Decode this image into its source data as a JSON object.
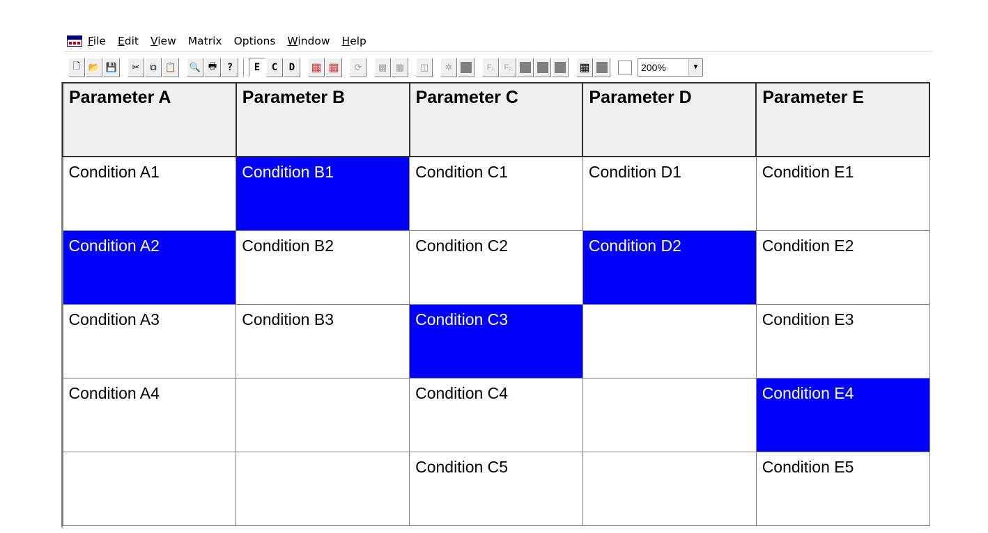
{
  "menu": {
    "items": [
      {
        "name": "file",
        "accel": "F",
        "rest": "ile"
      },
      {
        "name": "edit",
        "accel": "E",
        "rest": "dit"
      },
      {
        "name": "view",
        "accel": "V",
        "rest": "iew"
      },
      {
        "name": "matrix",
        "accel": "",
        "rest": "Matrix"
      },
      {
        "name": "options",
        "accel": "",
        "rest": "Options"
      },
      {
        "name": "window",
        "accel": "W",
        "rest": "indow"
      },
      {
        "name": "help",
        "accel": "H",
        "rest": "elp"
      }
    ]
  },
  "toolbar": {
    "mode_e": "E",
    "mode_c": "C",
    "mode_d": "D",
    "zoom_value": "200%",
    "zoom_arrow": "▼",
    "icons": {
      "new": "🗋",
      "open": "📂",
      "save": "💾",
      "cut": "✂",
      "copy": "⧉",
      "paste": "📋",
      "preview": "🔍",
      "print": "🖶",
      "help": "?",
      "refresh": "⟳",
      "star": "✲",
      "f1": "F₁",
      "f2": "F₂",
      "grid": "▦",
      "table_red": "▦",
      "table_red2": "▦",
      "grid_a": "▩",
      "grid_b": "▩",
      "single": "◫"
    }
  },
  "matrix": {
    "headers": [
      "Parameter A",
      "Parameter B",
      "Parameter C",
      "Parameter D",
      "Parameter E"
    ],
    "rows": [
      [
        {
          "text": "Condition A1",
          "selected": false
        },
        {
          "text": "Condition B1",
          "selected": true
        },
        {
          "text": "Condition C1",
          "selected": false
        },
        {
          "text": "Condition D1",
          "selected": false
        },
        {
          "text": "Condition E1",
          "selected": false
        }
      ],
      [
        {
          "text": "Condition A2",
          "selected": true
        },
        {
          "text": "Condition B2",
          "selected": false
        },
        {
          "text": "Condition C2",
          "selected": false
        },
        {
          "text": "Condition D2",
          "selected": true
        },
        {
          "text": "Condition E2",
          "selected": false
        }
      ],
      [
        {
          "text": "Condition A3",
          "selected": false
        },
        {
          "text": "Condition B3",
          "selected": false
        },
        {
          "text": "Condition C3",
          "selected": true
        },
        {
          "text": "",
          "selected": false
        },
        {
          "text": "Condition E3",
          "selected": false
        }
      ],
      [
        {
          "text": "Condition A4",
          "selected": false
        },
        {
          "text": "",
          "selected": false
        },
        {
          "text": "Condition C4",
          "selected": false
        },
        {
          "text": "",
          "selected": false
        },
        {
          "text": "Condition E4",
          "selected": true
        }
      ],
      [
        {
          "text": "",
          "selected": false
        },
        {
          "text": "",
          "selected": false
        },
        {
          "text": "Condition C5",
          "selected": false
        },
        {
          "text": "",
          "selected": false
        },
        {
          "text": "Condition E5",
          "selected": false
        }
      ]
    ]
  },
  "colors": {
    "selected_cell": "#0000ff",
    "selected_text": "#ffffff",
    "header_bg": "#f0f0f0",
    "disabled_red": "#d04040"
  }
}
